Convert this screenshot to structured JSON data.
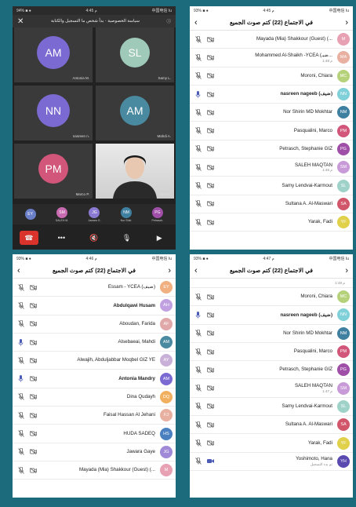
{
  "colors": {
    "bg": "#1b6b7c"
  },
  "p1": {
    "status": {
      "carrier": "94% ■ ●",
      "time": "4:45 م",
      "right": "中国电信 Iu"
    },
    "banner": "سياسة الخصوصية · بدأ شخص ما التسجيل والكتابة",
    "tiles": [
      {
        "initials": "AM",
        "label": "Antonia M.",
        "color": "#7b6ad1",
        "ring": true
      },
      {
        "initials": "SL",
        "label": "Samy L.",
        "color": "#9fc9b8",
        "ring": false
      },
      {
        "initials": "NN",
        "label": "nasreen n.",
        "color": "#7b6ad1",
        "ring": true
      },
      {
        "initials": "AM",
        "label": "Mahdi A.",
        "color": "#4a8aa0",
        "ring": false
      },
      {
        "initials": "PM",
        "label": "Marco P.",
        "color": "#d2567a",
        "ring": false
      },
      {
        "initials": "",
        "label": "Hana Y.",
        "color": "",
        "ring": false
      }
    ],
    "strip": [
      {
        "i": "EY",
        "l": "",
        "c": "#6b7fc9"
      },
      {
        "i": "SM",
        "l": "SALEH M.",
        "c": "#c96bb0"
      },
      {
        "i": "JG",
        "l": "Jawara G.",
        "c": "#8b7ad1"
      },
      {
        "i": "NM",
        "l": "Nor Shiri.",
        "c": "#3f7fa0"
      },
      {
        "i": "PG",
        "l": "Petrasch.",
        "c": "#a04fa8"
      }
    ],
    "ctrl": [
      "end-call",
      "more",
      "speaker",
      "mic",
      "video"
    ]
  },
  "p2": {
    "status": {
      "carrier": "93% ■ ●",
      "time": "4:45 م",
      "right": "中国电信 Iu"
    },
    "title": "في الاجتماع (22)  كتم صوت الجميع",
    "rows": [
      {
        "n": "Mayada (Mia) Shakkour (Guest) (...",
        "s": "",
        "c": "#e8a0b3",
        "a": "M",
        "m": "muted",
        "b": false
      },
      {
        "n": "Mohammed Al-Shaikh -YCEA (ضيـ...",
        "s": "1:48 م",
        "c": "#e8b0a0",
        "a": "MA",
        "m": "muted",
        "b": false
      },
      {
        "n": "Moroni, Chiara",
        "s": "",
        "c": "#b5d27a",
        "a": "MC",
        "m": "muted",
        "b": false
      },
      {
        "n": "nasreen nageeb (ضيف)",
        "s": "",
        "c": "#7fd0d8",
        "a": "NN",
        "m": "on",
        "b": true
      },
      {
        "n": "Nor Shirin MD Mokhtar",
        "s": "",
        "c": "#3f7fa0",
        "a": "NM",
        "m": "muted",
        "b": false
      },
      {
        "n": "Pasqualini, Marco",
        "s": "",
        "c": "#d2567a",
        "a": "PM",
        "m": "muted",
        "b": false
      },
      {
        "n": "Petrasch, Stephanie GIZ",
        "s": "",
        "c": "#a04fa8",
        "a": "PG",
        "m": "muted",
        "b": false
      },
      {
        "n": "SALEH MAQTAN",
        "s": "1:46 م",
        "c": "#c99ad8",
        "a": "SM",
        "m": "muted",
        "b": false
      },
      {
        "n": "Samy Lendvai-Karmout",
        "s": "",
        "c": "#9fd2c8",
        "a": "SL",
        "m": "muted",
        "b": false
      },
      {
        "n": "Sultana A. Al-Maswari",
        "s": "",
        "c": "#d2566a",
        "a": "SA",
        "m": "muted",
        "b": false
      },
      {
        "n": "Yarak, Fadi",
        "s": "",
        "c": "#e0d04a",
        "a": "YF",
        "m": "muted",
        "b": false
      }
    ]
  },
  "p3": {
    "status": {
      "carrier": "93% ■ ●",
      "time": "4:46 م",
      "right": "中国电信 Iu"
    },
    "title": "في الاجتماع (22)  كتم صوت الجميع",
    "rows": [
      {
        "n": "Essam - YCEA (ضيف)",
        "s": "",
        "c": "#f0b080",
        "a": "EY",
        "m": "muted",
        "b": false
      },
      {
        "n": "Abdulqawi Husam",
        "s": "",
        "c": "#c0a0e0",
        "a": "AH",
        "m": "muted",
        "b": true
      },
      {
        "n": "Aboudan, Farida",
        "s": "",
        "c": "#e0a8a8",
        "a": "AF",
        "m": "muted",
        "b": false
      },
      {
        "n": "Alsebaeai, Mahdi",
        "s": "",
        "c": "#4a8aa0",
        "a": "AM",
        "m": "on",
        "b": false
      },
      {
        "n": "Alwajih, Abduljabbar Moqbel GIZ YE",
        "s": "",
        "c": "#c9b0d8",
        "a": "AY",
        "m": "muted",
        "b": false
      },
      {
        "n": "Antonia Mandry",
        "s": "",
        "c": "#7b6ad1",
        "a": "AM",
        "m": "on",
        "b": true
      },
      {
        "n": "Dina Qudayh",
        "s": "",
        "c": "#f0b060",
        "a": "DQ",
        "m": "muted",
        "b": false
      },
      {
        "n": "Faisal Hassan Al Jehani",
        "s": "",
        "c": "#e8b0a0",
        "a": "FJ",
        "m": "muted",
        "b": false
      },
      {
        "n": "HUDA SADEQ",
        "s": "",
        "c": "#4a80c0",
        "a": "HS",
        "m": "muted",
        "b": false
      },
      {
        "n": "Jawara Gaye",
        "s": "",
        "c": "#a08ad8",
        "a": "JG",
        "m": "muted",
        "b": false
      },
      {
        "n": "Mayada (Mia) Shakkour (Guest) (...",
        "s": "",
        "c": "#e8a0b3",
        "a": "M",
        "m": "muted",
        "b": false
      }
    ]
  },
  "p4": {
    "status": {
      "carrier": "93% ■ ●",
      "time": "4:47 م",
      "right": "中国电信 Iu"
    },
    "title": "في الاجتماع (22)  كتم صوت الجميع",
    "top_sub": "1:48 م",
    "rows": [
      {
        "n": "Moroni, Chiara",
        "s": "",
        "c": "#b5d27a",
        "a": "MC",
        "m": "muted",
        "b": false
      },
      {
        "n": "nasreen nageeb (ضيف)",
        "s": "",
        "c": "#7fd0d8",
        "a": "NN",
        "m": "on",
        "b": true
      },
      {
        "n": "Nor Shirin MD Mokhtar",
        "s": "",
        "c": "#3f7fa0",
        "a": "NM",
        "m": "muted",
        "b": false
      },
      {
        "n": "Pasqualini, Marco",
        "s": "",
        "c": "#d2567a",
        "a": "PM",
        "m": "muted",
        "b": false
      },
      {
        "n": "Petrasch, Stephanie GIZ",
        "s": "",
        "c": "#a04fa8",
        "a": "PG",
        "m": "muted",
        "b": false
      },
      {
        "n": "SALEH MAQTAN",
        "s": "1:47 م",
        "c": "#c99ad8",
        "a": "SM",
        "m": "muted",
        "b": false
      },
      {
        "n": "Samy Lendvai-Karmout",
        "s": "",
        "c": "#9fd2c8",
        "a": "SL",
        "m": "muted",
        "b": false
      },
      {
        "n": "Sultana A. Al-Maswari",
        "s": "",
        "c": "#d2566a",
        "a": "SA",
        "m": "muted",
        "b": false
      },
      {
        "n": "Yarak, Fadi",
        "s": "",
        "c": "#e0d04a",
        "a": "YF",
        "m": "muted",
        "b": false
      },
      {
        "n": "Yoshimoto, Hana",
        "s": "تم بدء التسجيل",
        "c": "#5a4ab0",
        "a": "YH",
        "m": "video",
        "b": false
      }
    ]
  }
}
